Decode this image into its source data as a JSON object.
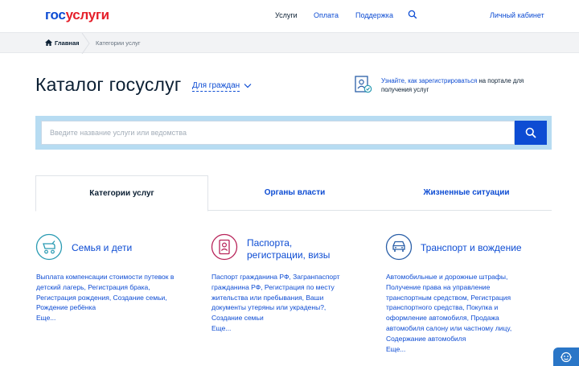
{
  "header": {
    "logo_part1": "гос",
    "logo_part2": "услуги",
    "nav": {
      "services": "Услуги",
      "payment": "Оплата",
      "support": "Поддержка",
      "cabinet": "Личный кабинет"
    },
    "search_icon": "search-icon"
  },
  "breadcrumb": {
    "home": "Главная",
    "current": "Категории услуг"
  },
  "page": {
    "title": "Каталог госуслуг",
    "audience": "Для граждан",
    "register_link": "Узнайте, как зарегистрироваться",
    "register_rest": " на портале для получения услуг"
  },
  "search": {
    "placeholder": "Введите название услуги или ведомства",
    "value": ""
  },
  "tabs": [
    {
      "label": "Категории услуг",
      "active": true
    },
    {
      "label": "Органы власти",
      "active": false
    },
    {
      "label": "Жизненные ситуации",
      "active": false
    }
  ],
  "categories": [
    {
      "title": "Семья и дети",
      "desc": "Выплата компенсации стоимости путевок в детский лагерь, Регистрация брака, Регистрация рождения, Создание семьи, Рождение ребёнка",
      "more": "Еще...",
      "icon": "stroller-icon"
    },
    {
      "title_line1": "Паспорта,",
      "title_line2": "регистрации, визы",
      "desc": "Паспорт гражданина РФ, Загранпаспорт гражданина РФ, Регистрация по месту жительства или пребывания, Ваши документы утеряны или украдены?, Создание семьи",
      "more": "Еще...",
      "icon": "passport-icon"
    },
    {
      "title": "Транспорт и вождение",
      "desc": "Автомобильные и дорожные штрафы, Получение права на управление транспортным средством, Регистрация транспортного средства, Покупка и оформление автомобиля, Продажа автомобиля салону или частному лицу, Содержание автомобиля",
      "more": "Еще...",
      "icon": "car-icon"
    }
  ],
  "colors": {
    "brand_blue": "#0d4cd3",
    "brand_red": "#e5202b",
    "family_accent": "#2a9bb3",
    "passport_accent": "#b8245a",
    "transport_accent": "#2a5fa8"
  }
}
